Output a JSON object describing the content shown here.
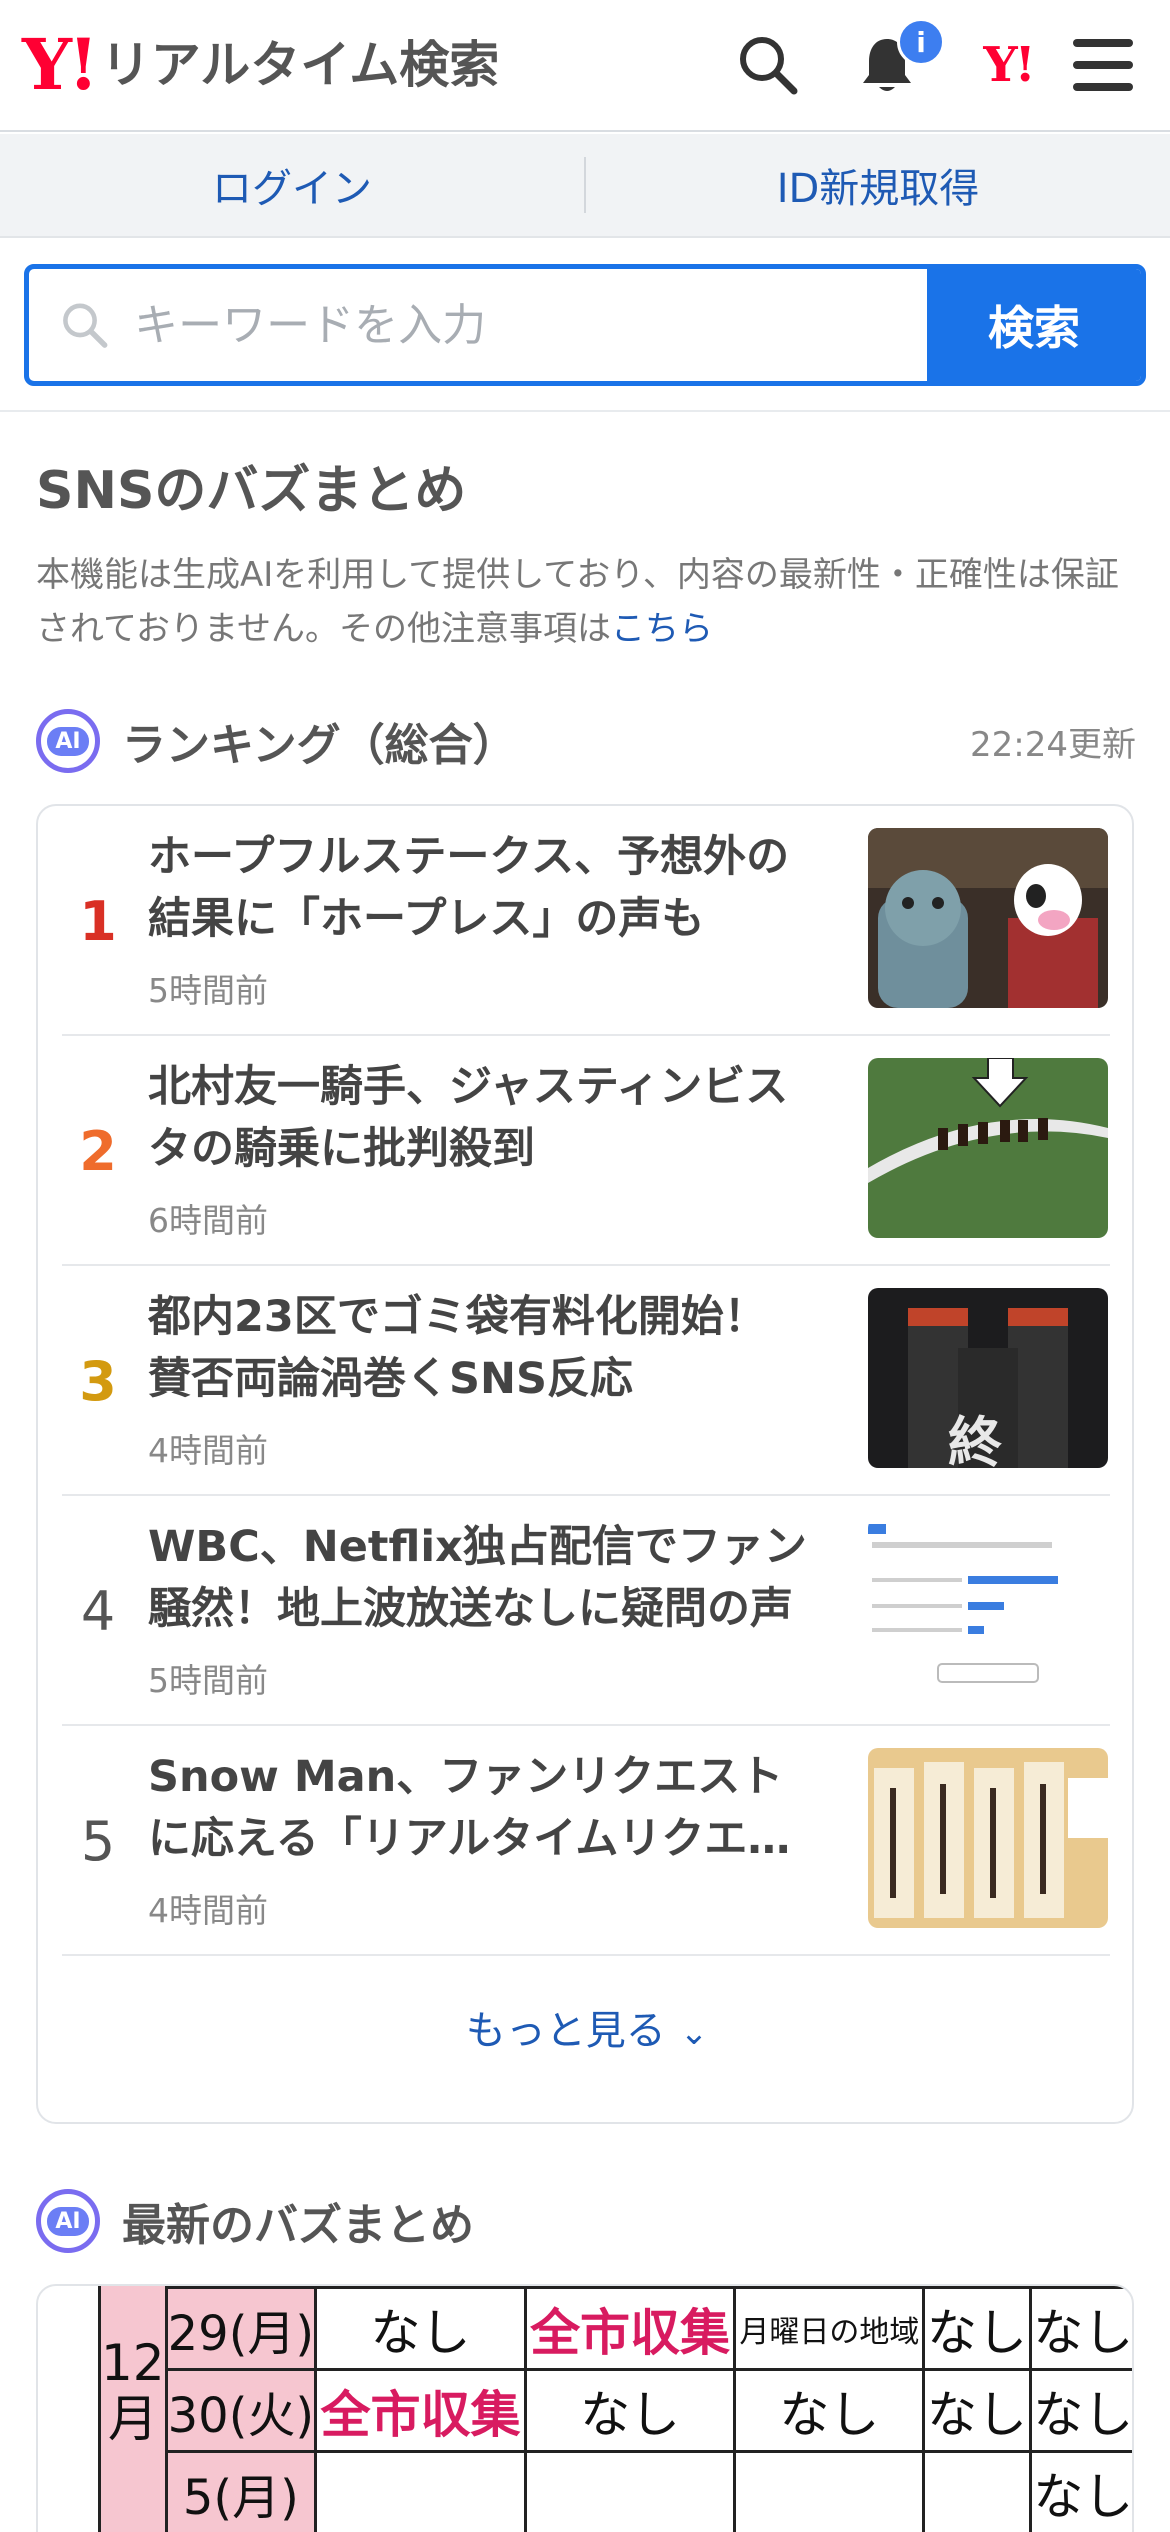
{
  "header": {
    "logo_mark": "Y!",
    "logo_text": "リアルタイム検索",
    "notification_badge": "i",
    "yj_mark": "Y!"
  },
  "auth": {
    "login": "ログイン",
    "register": "ID新規取得"
  },
  "search": {
    "placeholder": "キーワードを入力",
    "button": "検索"
  },
  "buzz": {
    "title": "SNSのバズまとめ",
    "disclaimer": "本機能は生成AIを利用して提供しており、内容の最新性・正確性は保証されておりません。その他注意事項は",
    "disclaimer_link": "こちら"
  },
  "ai_badge": "AI",
  "ranking": {
    "title": "ランキング（総合）",
    "updated": "22:24更新",
    "items": [
      {
        "rank": "1",
        "headline": "ホープフルステークス、予想外の結果に「ホープレス」の声も",
        "time": "5時間前",
        "rank_color": "#d93025"
      },
      {
        "rank": "2",
        "headline": "北村友一騎手、ジャスティンビスタの騎乗に批判殺到",
        "time": "6時間前",
        "rank_color": "#ef6c2c"
      },
      {
        "rank": "3",
        "headline": "都内23区でゴミ袋有料化開始！賛否両論渦巻くSNS反応",
        "time": "4時間前",
        "rank_color": "#d39a10"
      },
      {
        "rank": "4",
        "headline": "WBC、Netflix独占配信でファン騒然！地上波放送なしに疑問の声",
        "time": "5時間前",
        "rank_color": "#555555"
      },
      {
        "rank": "5",
        "headline": "Snow Man、ファンリクエストに応える「リアルタイムリクエ…",
        "time": "4時間前",
        "rank_color": "#555555"
      }
    ],
    "more": "もっと見る"
  },
  "thumb3_text": "終",
  "latest": {
    "title": "最新のバズまとめ",
    "table": {
      "month": "12月",
      "rows": [
        {
          "day": "29(月)",
          "cells": [
            "なし",
            "全市収集",
            "月曜日の地域",
            "なし",
            "なし"
          ]
        },
        {
          "day": "30(火)",
          "cells": [
            "全市収集",
            "なし",
            "なし",
            "なし",
            "なし"
          ]
        },
        {
          "day": "5(月)",
          "cells": [
            "",
            "",
            "",
            "",
            "なし"
          ]
        }
      ]
    }
  }
}
